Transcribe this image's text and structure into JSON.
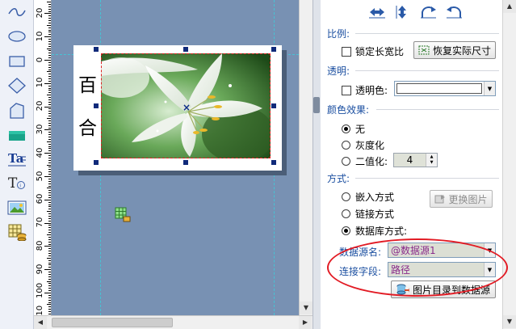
{
  "ruler": {
    "labels": [
      "20",
      "10",
      "0",
      "10",
      "20",
      "30",
      "40",
      "50",
      "60",
      "70",
      "80",
      "90",
      "100",
      "110"
    ]
  },
  "label_text": {
    "char1": "百",
    "char2": "合"
  },
  "panel": {
    "aspect_section": "比例:",
    "lock_aspect_label": "锁定长宽比",
    "restore_size_button": "恢复实际尺寸",
    "transparency_section": "透明:",
    "transparent_color_label": "透明色:",
    "color_effect_section": "颜色效果:",
    "color_options": [
      "无",
      "灰度化",
      "二值化:"
    ],
    "threshold_value": "4",
    "mode_section": "方式:",
    "mode_options": [
      "嵌入方式",
      "链接方式",
      "数据库方式:"
    ],
    "replace_image_button": "更换图片",
    "datasource_label": "数据源名:",
    "datasource_value": "@数据源1",
    "field_label": "连接字段:",
    "field_value": "路径",
    "image_dir_button": "图片目录到数据源"
  },
  "colors": {
    "canvas": "#7891b3",
    "section_title": "#1a4ea0",
    "annotation": "#e21b24",
    "guide": "#46c3d4"
  }
}
